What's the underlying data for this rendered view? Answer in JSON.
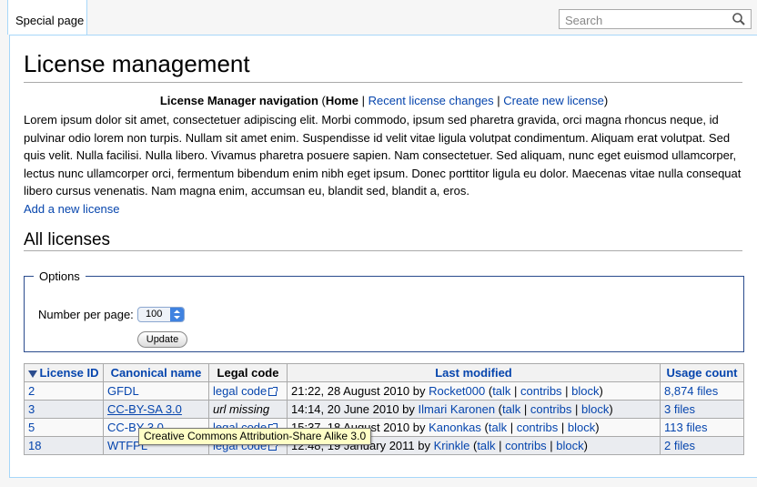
{
  "tabs": {
    "special_page": "Special page"
  },
  "search": {
    "placeholder": "Search"
  },
  "page": {
    "title": "License management",
    "nav": {
      "label": "License Manager navigation",
      "open": " (",
      "current": "Home",
      "sep1": " | ",
      "link1": "Recent license changes",
      "sep2": " | ",
      "link2": "Create new license",
      "close": ")"
    },
    "intro": "Lorem ipsum dolor sit amet, consectetuer adipiscing elit. Morbi commodo, ipsum sed pharetra gravida, orci magna rhoncus neque, id pulvinar odio lorem non turpis. Nullam sit amet enim. Suspendisse id velit vitae ligula volutpat condimentum. Aliquam erat volutpat. Sed quis velit. Nulla facilisi. Nulla libero. Vivamus pharetra posuere sapien. Nam consectetuer. Sed aliquam, nunc eget euismod ullamcorper, lectus nunc ullamcorper orci, fermentum bibendum enim nibh eget ipsum. Donec porttitor ligula eu dolor. Maecenas vitae nulla consequat libero cursus venenatis. Nam magna enim, accumsan eu, blandit sed, blandit a, eros.",
    "add_link": "Add a new license",
    "section_title": "All licenses"
  },
  "options": {
    "legend": "Options",
    "number_label": "Number per page:",
    "number_value": "100",
    "update_button": "Update"
  },
  "table": {
    "headers": {
      "license_id": "License ID",
      "canonical_name": "Canonical name",
      "legal_code": "Legal code",
      "last_modified": "Last modified",
      "usage_count": "Usage count"
    },
    "rows": [
      {
        "id": "2",
        "name": "GFDL",
        "legal": "legal code",
        "date": "21:22, 28 August 2010 by ",
        "user": "Rocket000",
        "talk": "talk",
        "contribs": "contribs",
        "block": "block",
        "usage": "8,874 files"
      },
      {
        "id": "3",
        "name": "CC-BY-SA 3.0",
        "legal": "url missing",
        "date": "14:14, 20 June 2010 by ",
        "user": "Ilmari Karonen",
        "talk": "talk",
        "contribs": "contribs",
        "block": "block",
        "usage": "3 files"
      },
      {
        "id": "5",
        "name": "CC-BY 3.0",
        "legal": "legal code",
        "date": "15:37, 18 August 2010 by ",
        "user": "Kanonkas",
        "talk": "talk",
        "contribs": "contribs",
        "block": "block",
        "usage": "113 files"
      },
      {
        "id": "18",
        "name": "WTFPL",
        "legal": "legal code",
        "date": "12:48, 19 January 2011 by ",
        "user": "Krinkle",
        "talk": "talk",
        "contribs": "contribs",
        "block": "block",
        "usage": "2 files"
      }
    ]
  },
  "tooltip": "Creative Commons Attribution-Share Alike 3.0"
}
